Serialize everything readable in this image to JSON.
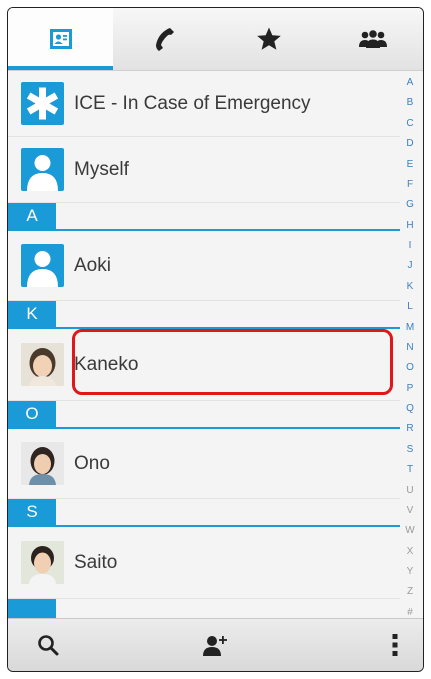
{
  "tabs": [
    {
      "icon": "contacts-icon",
      "selected": true
    },
    {
      "icon": "phone-icon",
      "selected": false
    },
    {
      "icon": "star-icon",
      "selected": false
    },
    {
      "icon": "groups-icon",
      "selected": false
    }
  ],
  "contacts": {
    "ice": {
      "name": "ICE - In Case of Emergency",
      "icon": "ice-star-of-life-icon"
    },
    "myself": {
      "name": "Myself",
      "icon": "default-avatar-icon"
    },
    "aoki": {
      "name": "Aoki",
      "icon": "default-avatar-icon"
    },
    "kaneko": {
      "name": "Kaneko",
      "icon": "photo-avatar"
    },
    "ono": {
      "name": "Ono",
      "icon": "photo-avatar"
    },
    "saito": {
      "name": "Saito",
      "icon": "photo-avatar"
    }
  },
  "sections": {
    "a": "A",
    "k": "K",
    "o": "O",
    "s": "S"
  },
  "index_letters": [
    "A",
    "B",
    "C",
    "D",
    "E",
    "F",
    "G",
    "H",
    "I",
    "J",
    "K",
    "L",
    "M",
    "N",
    "O",
    "P",
    "Q",
    "R",
    "S",
    "T",
    "U",
    "V",
    "W",
    "X",
    "Y",
    "Z",
    "#"
  ],
  "bottom_bar": [
    {
      "icon": "search-icon"
    },
    {
      "icon": "add-contact-icon"
    },
    {
      "icon": "overflow-menu-icon"
    }
  ],
  "colors": {
    "accent": "#1a9ad6",
    "highlight": "#e0161b",
    "text": "#3a3a3a",
    "index": "#3c7fc0"
  }
}
